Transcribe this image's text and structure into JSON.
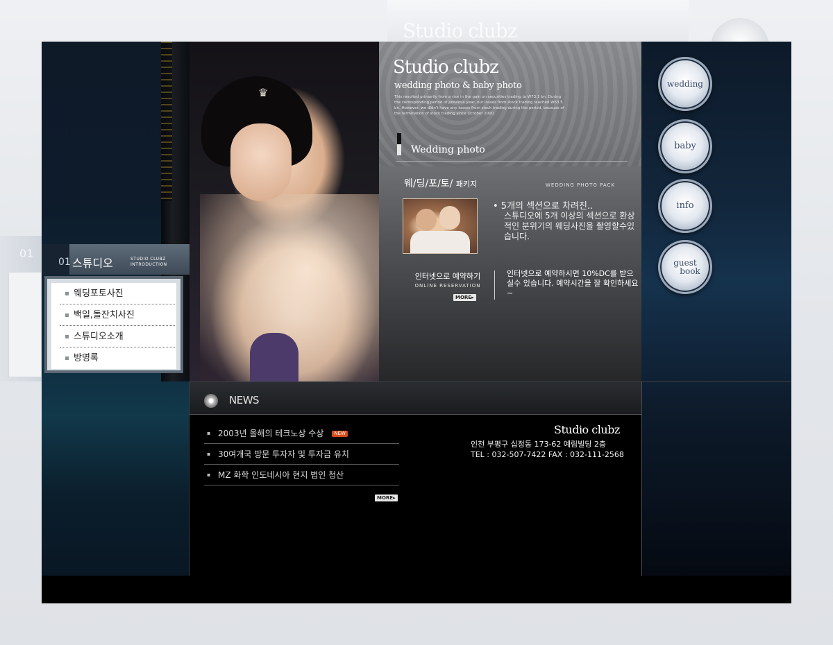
{
  "background": {
    "ghost_title": "Studio clubz",
    "ghost_num": "01"
  },
  "brand": {
    "title": "Studio clubz",
    "subtitle": "wedding photo & baby photo",
    "description": "This resulted primarily from a rise in the gain on securities trading to W73.1 bn. During the corresponding period of previous year, our losses from stock trading reached W63.5 bn. However, we didn't have any losses from stock trading during the period, because of the termination of stock trading since October 2000."
  },
  "wedding_section": {
    "title": "Wedding photo",
    "package_title": "웨/딩/포/토/",
    "package_suffix": "패키지",
    "package_eng": "WEDDING PHOTO PACK",
    "bullet": "• 5개의 섹션으로 차려진..",
    "description": "스튜디오에 5개 이상의 섹션으로 환상적인 분위기의 웨딩사진을 촬영할수있습니다."
  },
  "reservation": {
    "title": "인터넷으로 예약하기",
    "eng": "ONLINE RESERVATION",
    "more": "MORE▸",
    "description": "인터넷으로 예약하시면 10%DC를 받으실수 있습니다. 예약시간을 잘 확인하세요~"
  },
  "nav": {
    "wedding": "wedding",
    "baby": "baby",
    "info": "info",
    "guest": "guest",
    "book": "book"
  },
  "sidebar": {
    "num": "01",
    "title": "스튜디오",
    "eng_line1": "STUDIO CLUBZ",
    "eng_line2": "INTRODUCTION",
    "items": [
      {
        "label": "웨딩포토사진"
      },
      {
        "label": "백일,돌잔치사진"
      },
      {
        "label": "스튜디오소개"
      },
      {
        "label": "방명록"
      }
    ]
  },
  "news": {
    "title": "NEWS",
    "new_badge": "NEW",
    "more": "MORE▸",
    "items": [
      {
        "label": "2003년 올해의 테크노상 수상"
      },
      {
        "label": "30여개국 방문 투자자 및 투자금 유치"
      },
      {
        "label": "MZ 화학 인도네시아 현지 법인 청산"
      }
    ]
  },
  "footer": {
    "brand": "Studio clubz",
    "address": "인천 부평구 십정동 173-62 예림빌딩 2층",
    "tel": "TEL : 032-507-7422   FAX : 032-111-2568"
  },
  "colors": {
    "background": "#e3e6ea",
    "panel": "#000000",
    "nav_text": "#3b4a6a",
    "new_badge": "#d84a1a"
  }
}
